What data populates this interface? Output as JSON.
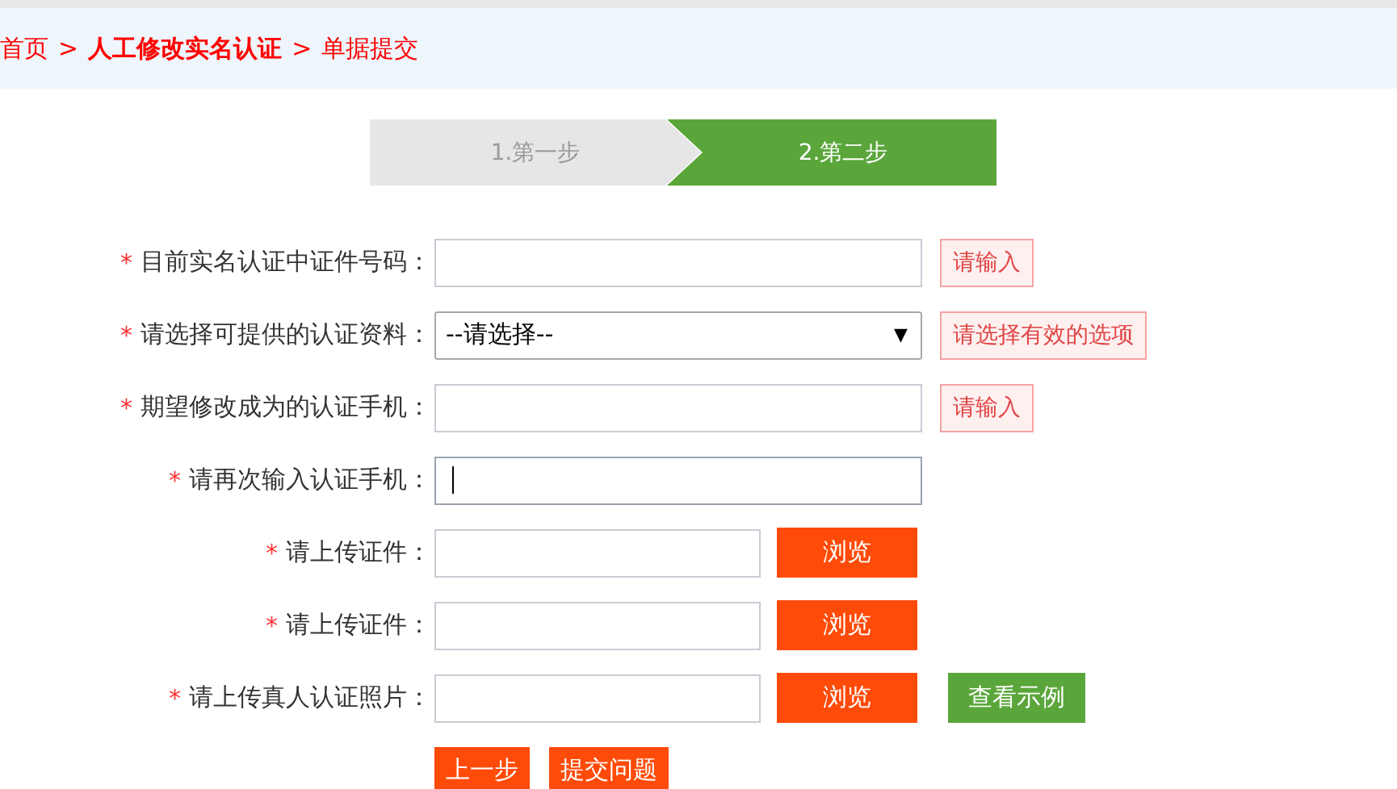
{
  "breadcrumb": [
    {
      "kind": "link",
      "text": "首页"
    },
    {
      "kind": "sep",
      "text": ">"
    },
    {
      "kind": "strong",
      "text": "人工修改实名认证"
    },
    {
      "kind": "sep",
      "text": ">"
    },
    {
      "kind": "plain",
      "text": "单据提交"
    }
  ],
  "steps": [
    {
      "label": "1.第一步",
      "selected": false
    },
    {
      "label": "2.第二步",
      "selected": true
    }
  ],
  "form": [
    {
      "mark": "*",
      "label": "目前实名认证中证件号码：",
      "field": {
        "kind": "text",
        "focused": false
      },
      "hint": "请输入"
    },
    {
      "mark": "*",
      "label": "请选择可提供的认证资料：",
      "field": {
        "kind": "select",
        "value": "--请选择--",
        "arrow": "▼"
      },
      "hint": "请选择有效的选项"
    },
    {
      "mark": "*",
      "label": "期望修改成为的认证手机：",
      "field": {
        "kind": "text",
        "focused": false
      },
      "hint": "请输入"
    },
    {
      "mark": "*",
      "label": "请再次输入认证手机：",
      "field": {
        "kind": "text",
        "focused": true
      }
    },
    {
      "mark": "*",
      "label": "请上传证件：",
      "field": {
        "kind": "file",
        "button": "浏览"
      }
    },
    {
      "mark": "*",
      "label": "请上传证件：",
      "field": {
        "kind": "file",
        "button": "浏览"
      }
    },
    {
      "mark": "*",
      "label": "请上传真人认证照片：",
      "field": {
        "kind": "file",
        "button": "浏览"
      },
      "extra_button": "查看示例"
    }
  ],
  "actions": [
    "上一步",
    "提交问题"
  ]
}
